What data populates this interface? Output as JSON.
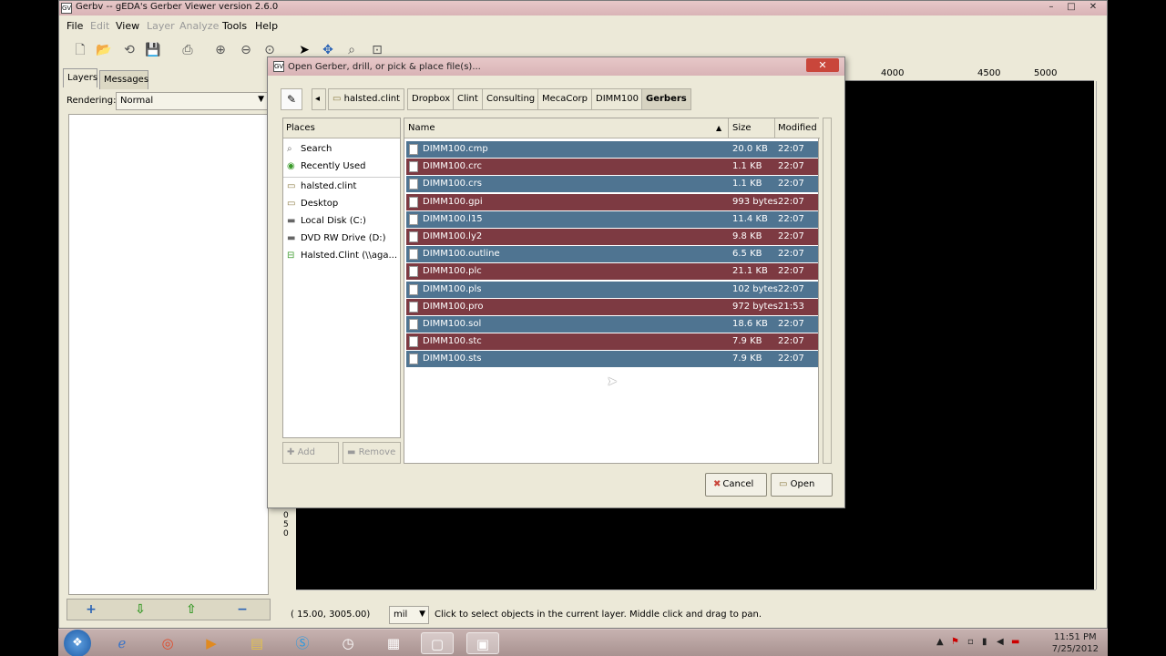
{
  "window": {
    "title": "Gerbv -- gEDA's Gerber Viewer version 2.6.0",
    "app_icon": "gerbv-icon",
    "controls": {
      "minimize": "–",
      "maximize": "□",
      "close": "✕"
    }
  },
  "menu": {
    "file": "File",
    "edit": "Edit",
    "view": "View",
    "layer": "Layer",
    "analyze": "Analyze",
    "tools": "Tools",
    "help": "Help"
  },
  "tabs": {
    "layers": "Layers",
    "messages": "Messages"
  },
  "rendering": {
    "label": "Rendering:",
    "value": "Normal"
  },
  "ruler": {
    "t4000": "4000",
    "t4500": "4500",
    "t5000": "5000",
    "left": "0 5 0"
  },
  "status": {
    "coords": "(   15.00,  3005.00)",
    "unit": "mil",
    "message": "Click to select objects in the current layer. Middle click and drag to pan."
  },
  "dialog": {
    "title": "Open Gerber, drill, or pick & place file(s)...",
    "breadcrumbs": [
      "halsted.clint",
      "Dropbox",
      "Clint",
      "Consulting",
      "MecaCorp",
      "DIMM100",
      "Gerbers"
    ],
    "places_header": "Places",
    "places": [
      {
        "label": "Search",
        "icon": "search-icon"
      },
      {
        "label": "Recently Used",
        "icon": "recent-icon"
      },
      {
        "label": "halsted.clint",
        "icon": "folder-icon"
      },
      {
        "label": "Desktop",
        "icon": "folder-icon"
      },
      {
        "label": "Local Disk (C:)",
        "icon": "drive-icon"
      },
      {
        "label": "DVD RW Drive (D:)",
        "icon": "dvd-icon"
      },
      {
        "label": "Halsted.Clint (\\\\aga...",
        "icon": "network-drive-icon"
      }
    ],
    "add_label": "Add",
    "remove_label": "Remove",
    "columns": {
      "name": "Name",
      "size": "Size",
      "modified": "Modified"
    },
    "files": [
      {
        "name": "DIMM100.cmp",
        "size": "20.0 KB",
        "modified": "22:07"
      },
      {
        "name": "DIMM100.crc",
        "size": "1.1 KB",
        "modified": "22:07"
      },
      {
        "name": "DIMM100.crs",
        "size": "1.1 KB",
        "modified": "22:07"
      },
      {
        "name": "DIMM100.gpi",
        "size": "993 bytes",
        "modified": "22:07"
      },
      {
        "name": "DIMM100.l15",
        "size": "11.4 KB",
        "modified": "22:07"
      },
      {
        "name": "DIMM100.ly2",
        "size": "9.8 KB",
        "modified": "22:07"
      },
      {
        "name": "DIMM100.outline",
        "size": "6.5 KB",
        "modified": "22:07"
      },
      {
        "name": "DIMM100.plc",
        "size": "21.1 KB",
        "modified": "22:07"
      },
      {
        "name": "DIMM100.pls",
        "size": "102 bytes",
        "modified": "22:07"
      },
      {
        "name": "DIMM100.pro",
        "size": "972 bytes",
        "modified": "21:53"
      },
      {
        "name": "DIMM100.sol",
        "size": "18.6 KB",
        "modified": "22:07"
      },
      {
        "name": "DIMM100.stc",
        "size": "7.9 KB",
        "modified": "22:07"
      },
      {
        "name": "DIMM100.sts",
        "size": "7.9 KB",
        "modified": "22:07"
      }
    ],
    "cancel_label": "Cancel",
    "open_label": "Open"
  },
  "taskbar": {
    "time": "11:51 PM",
    "date": "7/25/2012"
  },
  "colors": {
    "row_blue": "#4f7491",
    "row_red": "#7d3a42",
    "titlebar": "#d9b3b6",
    "close_button": "#c9463b"
  }
}
